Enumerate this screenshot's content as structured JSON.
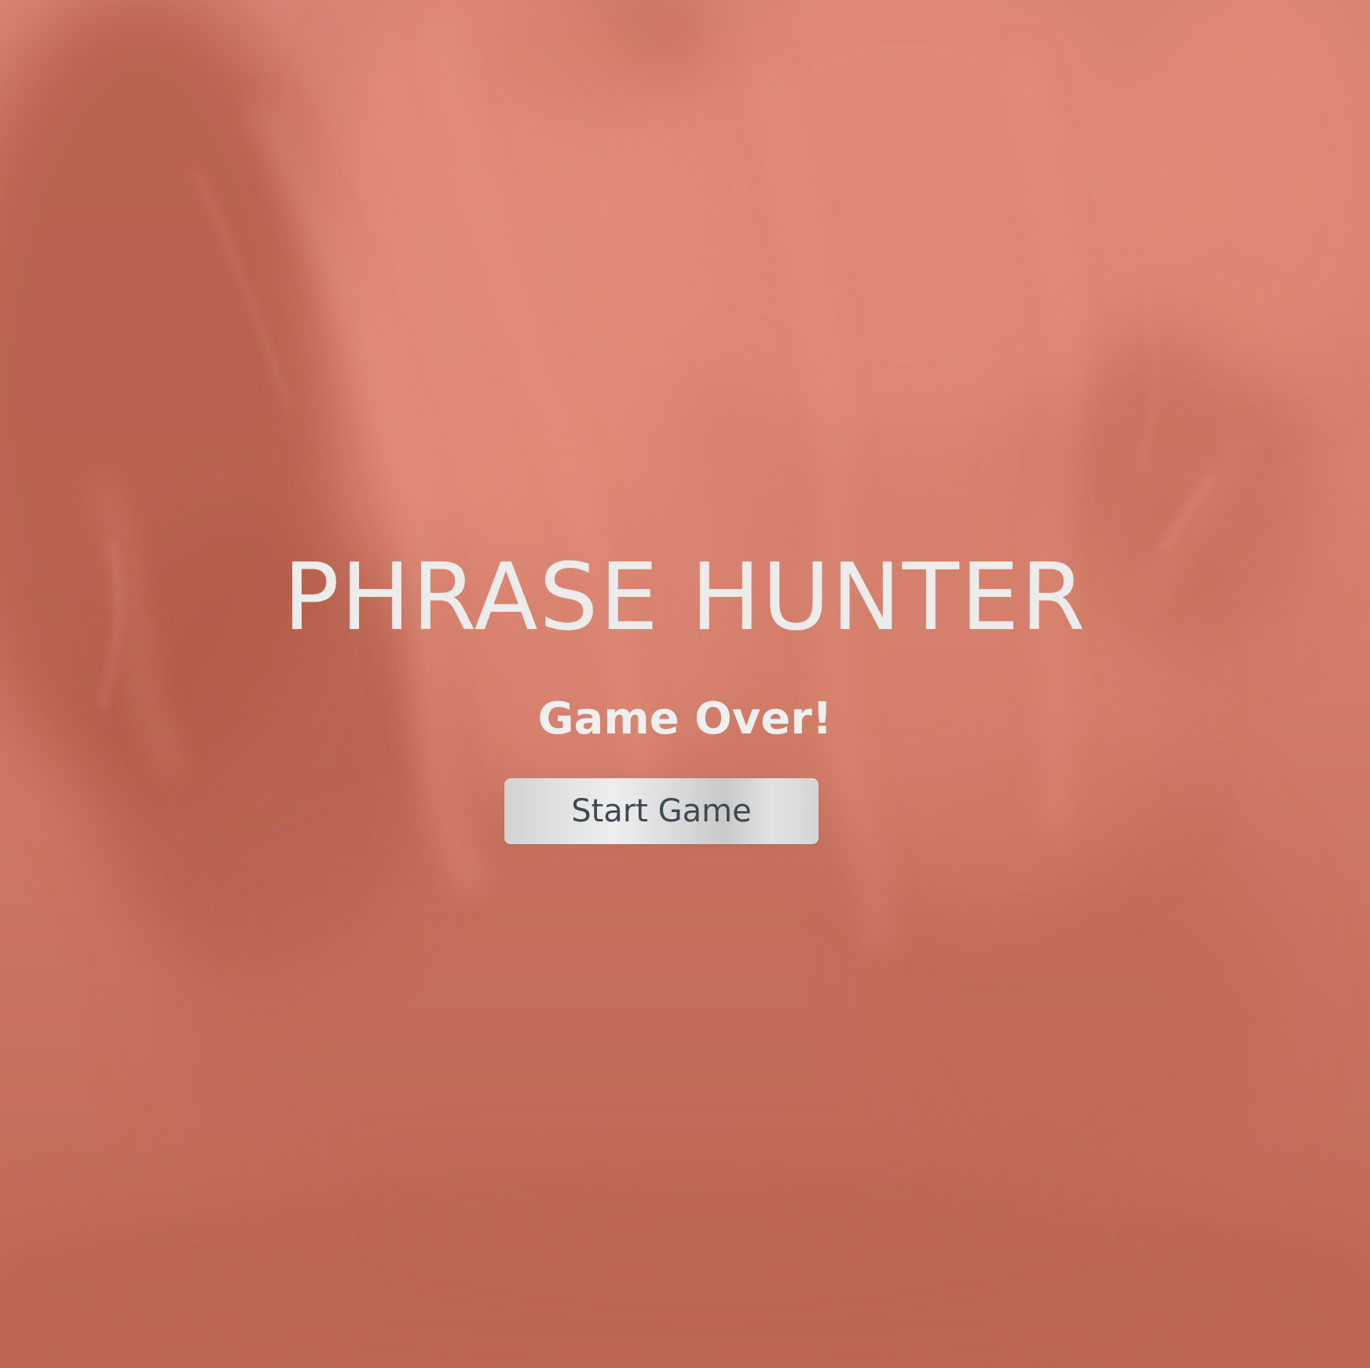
{
  "game": {
    "title": "PHRASE HUNTER",
    "status_message": "Game Over!",
    "start_button_label": "Start Game"
  },
  "colors": {
    "background_base": "#c97663",
    "background_light": "#e08b77",
    "background_dark": "#b3624f",
    "title_text": "#ececec",
    "button_text": "#3e4a52",
    "button_face": "#e0e0e0"
  }
}
